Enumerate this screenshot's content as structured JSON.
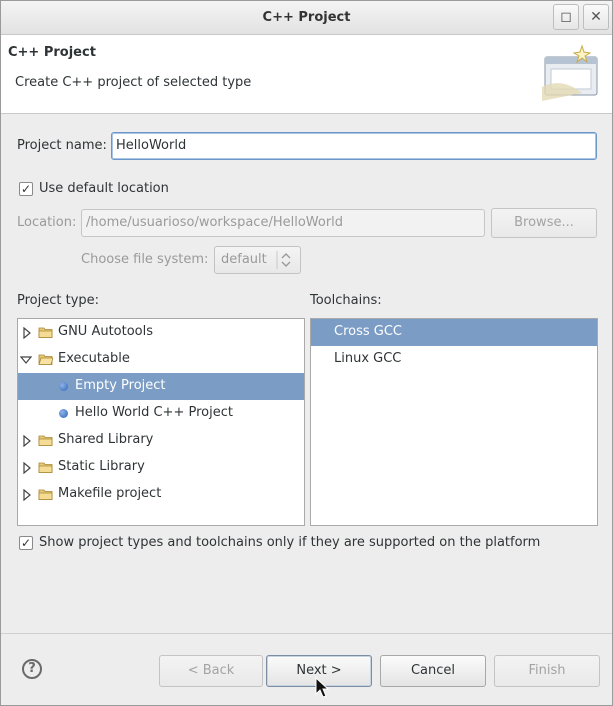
{
  "window": {
    "title": "C++ Project",
    "restore_symbol": "◻",
    "close_symbol": "✕"
  },
  "banner": {
    "title": "C++ Project",
    "description": "Create C++ project of selected type",
    "icon": "new-project-wizard-icon"
  },
  "form": {
    "project_name_label": "Project name:",
    "project_name_value": "HelloWorld",
    "use_default_location_label": "Use default location",
    "use_default_location_checked": true,
    "location_label": "Location:",
    "location_value": "/home/usuarioso/workspace/HelloWorld",
    "browse_label": "Browse...",
    "file_system_label": "Choose file system:",
    "file_system_value": "default"
  },
  "project_type": {
    "label": "Project type:",
    "items": [
      {
        "label": "GNU Autotools",
        "kind": "folder",
        "expanded": false,
        "level": 0
      },
      {
        "label": "Executable",
        "kind": "folder",
        "expanded": true,
        "level": 0
      },
      {
        "label": "Empty Project",
        "kind": "leaf",
        "level": 1,
        "selected": true
      },
      {
        "label": "Hello World C++ Project",
        "kind": "leaf",
        "level": 1
      },
      {
        "label": "Shared Library",
        "kind": "folder",
        "expanded": false,
        "level": 0
      },
      {
        "label": "Static Library",
        "kind": "folder",
        "expanded": false,
        "level": 0
      },
      {
        "label": "Makefile project",
        "kind": "folder",
        "expanded": false,
        "level": 0
      }
    ]
  },
  "toolchains": {
    "label": "Toolchains:",
    "items": [
      {
        "label": "Cross GCC",
        "selected": true
      },
      {
        "label": "Linux GCC",
        "selected": false
      }
    ]
  },
  "filter": {
    "label": "Show project types and toolchains only if they are supported on the platform",
    "checked": true
  },
  "buttons": {
    "back": "< Back",
    "next": "Next >",
    "cancel": "Cancel",
    "finish": "Finish",
    "help_symbol": "?"
  },
  "colors": {
    "selection": "#7b9cc5",
    "window_bg": "#ededed"
  }
}
